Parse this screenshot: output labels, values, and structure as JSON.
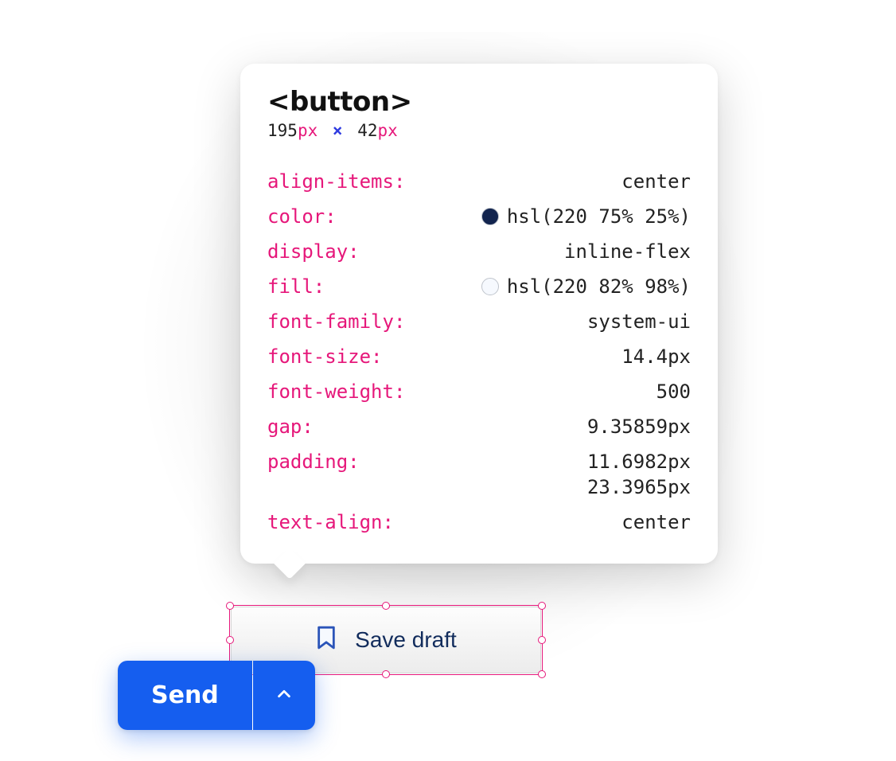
{
  "inspector": {
    "tag": "<button>",
    "width_num": "195",
    "width_unit": "px",
    "times": "×",
    "height_num": "42",
    "height_unit": "px",
    "props": [
      {
        "name": "align-items",
        "values": [
          "center"
        ],
        "swatch": null
      },
      {
        "name": "color",
        "values": [
          "hsl(220 75% 25%)"
        ],
        "swatch": "#12244e"
      },
      {
        "name": "display",
        "values": [
          "inline-flex"
        ],
        "swatch": null
      },
      {
        "name": "fill",
        "values": [
          "hsl(220 82% 98%)"
        ],
        "swatch": "#f6f9fe"
      },
      {
        "name": "font-family",
        "values": [
          "system-ui"
        ],
        "swatch": null
      },
      {
        "name": "font-size",
        "values": [
          "14.4px"
        ],
        "swatch": null
      },
      {
        "name": "font-weight",
        "values": [
          "500"
        ],
        "swatch": null
      },
      {
        "name": "gap",
        "values": [
          "9.35859px"
        ],
        "swatch": null
      },
      {
        "name": "padding",
        "values": [
          "11.6982px",
          "23.3965px"
        ],
        "swatch": null
      },
      {
        "name": "text-align",
        "values": [
          "center"
        ],
        "swatch": null
      }
    ]
  },
  "buttons": {
    "save_draft_label": "Save draft",
    "send_label": "Send"
  },
  "colors": {
    "pink": "#e6177a",
    "swatch_dark": "#12244e",
    "swatch_light": "#f6f9fe",
    "send_blue": "#155eef"
  }
}
